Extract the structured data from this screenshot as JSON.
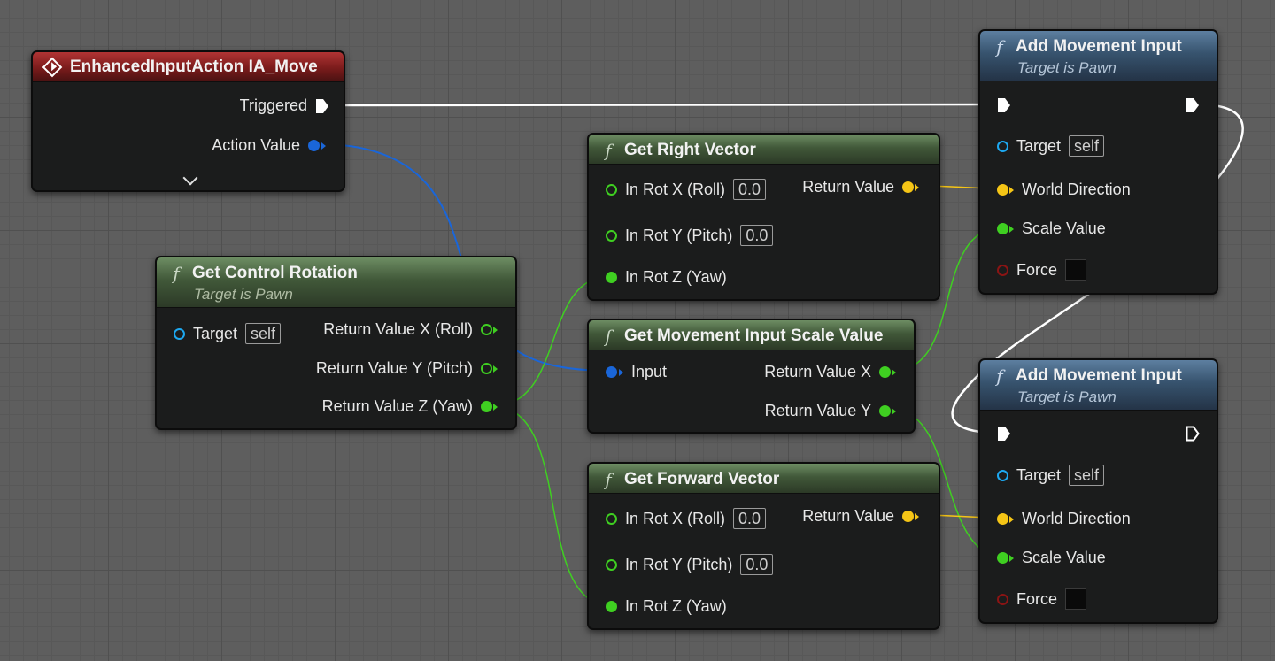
{
  "colors": {
    "event_header": "#9e2a2a",
    "pure_function_header": "#4d6b45",
    "function_header": "#3f5e7c",
    "exec_wire": "#ffffff",
    "struct_wire": "#1a66d9",
    "float_wire": "#3fcf21",
    "vector_wire": "#f5c516",
    "object_pin": "#1da8f0",
    "bool_pin": "#8a1414"
  },
  "event_node": {
    "title": "EnhancedInputAction IA_Move",
    "icon": "event-diamond-icon",
    "pins": {
      "triggered": "Triggered",
      "action_value": "Action Value"
    },
    "expand_icon": "chevron-down-icon"
  },
  "get_control_rotation": {
    "title": "Get Control Rotation",
    "subtitle": "Target is Pawn",
    "target_label": "Target",
    "target_value": "self",
    "outputs": [
      "Return Value X (Roll)",
      "Return Value Y (Pitch)",
      "Return Value Z (Yaw)"
    ]
  },
  "get_right_vector": {
    "title": "Get Right Vector",
    "inputs": [
      {
        "label": "In Rot X (Roll)",
        "value": "0.0"
      },
      {
        "label": "In Rot Y (Pitch)",
        "value": "0.0"
      },
      {
        "label": "In Rot Z (Yaw)"
      }
    ],
    "output": "Return Value"
  },
  "get_movement_input_scale": {
    "title": "Get Movement Input Scale Value",
    "input": "Input",
    "outputs": [
      "Return Value X",
      "Return Value Y"
    ]
  },
  "get_forward_vector": {
    "title": "Get Forward Vector",
    "inputs": [
      {
        "label": "In Rot X (Roll)",
        "value": "0.0"
      },
      {
        "label": "In Rot Y (Pitch)",
        "value": "0.0"
      },
      {
        "label": "In Rot Z (Yaw)"
      }
    ],
    "output": "Return Value"
  },
  "add_movement_1": {
    "title": "Add Movement Input",
    "subtitle": "Target is Pawn",
    "target_label": "Target",
    "target_value": "self",
    "world_direction": "World Direction",
    "scale_value": "Scale Value",
    "force": "Force"
  },
  "add_movement_2": {
    "title": "Add Movement Input",
    "subtitle": "Target is Pawn",
    "target_label": "Target",
    "target_value": "self",
    "world_direction": "World Direction",
    "scale_value": "Scale Value",
    "force": "Force"
  }
}
